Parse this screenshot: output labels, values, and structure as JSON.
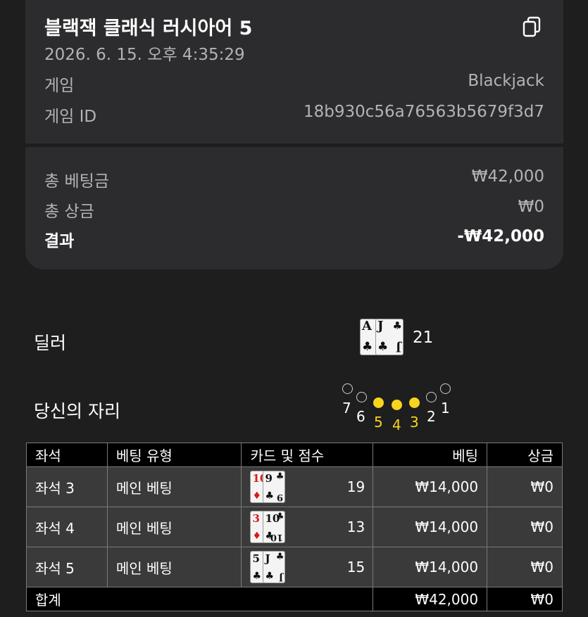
{
  "header": {
    "title": "블랙잭 클래식 러시아어 5",
    "datetime": "2026. 6. 15. 오후 4:35:29",
    "copy_icon": "copy-icon"
  },
  "info": {
    "game_label": "게임",
    "game_value": "Blackjack",
    "game_id_label": "게임 ID",
    "game_id_value": "18b930c56a76563b5679f3d7"
  },
  "summary": {
    "total_bet_label": "총 베팅금",
    "total_bet_value": "₩42,000",
    "total_win_label": "총 상금",
    "total_win_value": "₩0",
    "result_label": "결과",
    "result_value": "-₩42,000"
  },
  "dealer": {
    "label": "딜러",
    "cards": [
      {
        "rank": "A",
        "suit": "♣",
        "color": "black"
      },
      {
        "rank": "J",
        "suit": "♣",
        "color": "black"
      }
    ],
    "score": "21"
  },
  "seats": {
    "label": "당신의 자리",
    "numbers": [
      "7",
      "6",
      "5",
      "4",
      "3",
      "2",
      "1"
    ],
    "mine": [
      "5",
      "4",
      "3"
    ]
  },
  "table": {
    "headers": {
      "seat": "좌석",
      "bet_type": "베팅 유형",
      "cards_score": "카드 및 점수",
      "bet": "베팅",
      "win": "상금"
    },
    "rows": [
      {
        "seat": "좌석 3",
        "bet_type": "메인 베팅",
        "cards": [
          {
            "rank": "10",
            "suit": "♦",
            "color": "red"
          },
          {
            "rank": "9",
            "suit": "♣",
            "color": "black"
          }
        ],
        "score": "19",
        "bet": "₩14,000",
        "win": "₩0"
      },
      {
        "seat": "좌석 4",
        "bet_type": "메인 베팅",
        "cards": [
          {
            "rank": "3",
            "suit": "♦",
            "color": "red"
          },
          {
            "rank": "10",
            "suit": "♣",
            "color": "black"
          }
        ],
        "score": "13",
        "bet": "₩14,000",
        "win": "₩0"
      },
      {
        "seat": "좌석 5",
        "bet_type": "메인 베팅",
        "cards": [
          {
            "rank": "5",
            "suit": "♣",
            "color": "black"
          },
          {
            "rank": "J",
            "suit": "♣",
            "color": "black"
          }
        ],
        "score": "15",
        "bet": "₩14,000",
        "win": "₩0"
      }
    ],
    "footer": {
      "label": "합계",
      "bet_total": "₩42,000",
      "win_total": "₩0"
    }
  },
  "colors": {
    "background": "#1e1e1e",
    "card": "#2c2c2e",
    "seat_mine": "#f7d51d",
    "red_suit": "#d81b1b"
  }
}
